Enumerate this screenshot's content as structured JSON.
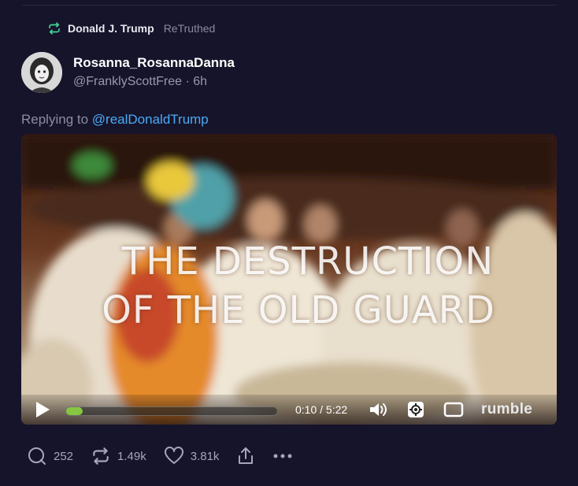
{
  "retruth": {
    "name": "Donald J. Trump",
    "label": "ReTruthed"
  },
  "post": {
    "author_name": "Rosanna_RosannaDanna",
    "author_handle": "@FranklyScottFree",
    "time": "6h",
    "reply_prefix": "Replying to",
    "reply_mention": "@realDonaldTrump"
  },
  "video": {
    "overlay_line1": "THE DESTRUCTION",
    "overlay_line2": "OF THE OLD GUARD",
    "time_display": "0:10 / 5:22",
    "progress_fraction": 0.03,
    "provider": "rumble",
    "accent_color": "#85c742"
  },
  "actions": {
    "replies": "252",
    "retruths": "1.49k",
    "likes": "3.81k"
  },
  "colors": {
    "background": "#16142a",
    "mention": "#4aaaf5",
    "retruth_icon": "#3fd69a"
  }
}
